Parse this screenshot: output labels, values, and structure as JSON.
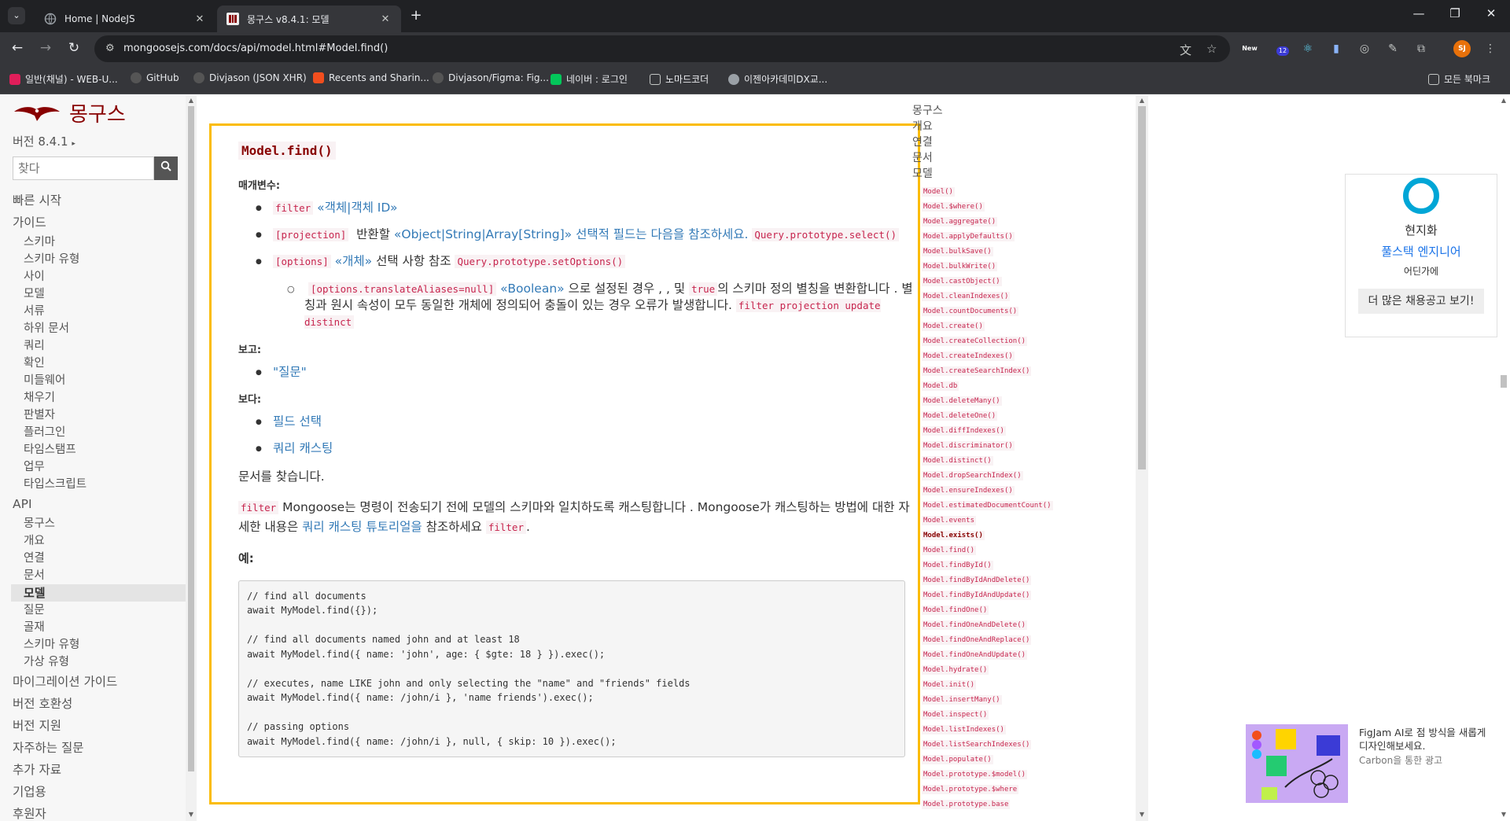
{
  "tabs": [
    {
      "title": "Home | NodeJS"
    },
    {
      "title": "몽구스 v8.4.1: 모델"
    }
  ],
  "address_bar": {
    "url": "mongoosejs.com/docs/api/model.html#Model.find()"
  },
  "extensions": {
    "new_label": "New",
    "badge_count": "12",
    "profile_initials": "SJ"
  },
  "bookmarks": {
    "items": [
      "일반(채널) - WEB-U...",
      "GitHub",
      "Divjason (JSON XHR)",
      "Recents and Sharin...",
      "Divjason/Figma: Fig...",
      "네이버 : 로그인",
      "노마드코더",
      "이젠아카데미DX교..."
    ],
    "all_bookmarks": "모든 북마크"
  },
  "sidebar": {
    "logo_text": "몽구스",
    "version": "버전 8.4.1",
    "search_placeholder": "찾다",
    "nav": [
      {
        "label": "빠른 시작",
        "level": "top"
      },
      {
        "label": "가이드",
        "level": "top"
      },
      {
        "label": "스키마",
        "level": "sub"
      },
      {
        "label": "스키마 유형",
        "level": "sub"
      },
      {
        "label": "사이",
        "level": "sub"
      },
      {
        "label": "모델",
        "level": "sub"
      },
      {
        "label": "서류",
        "level": "sub"
      },
      {
        "label": "하위 문서",
        "level": "sub"
      },
      {
        "label": "쿼리",
        "level": "sub"
      },
      {
        "label": "확인",
        "level": "sub"
      },
      {
        "label": "미들웨어",
        "level": "sub"
      },
      {
        "label": "채우기",
        "level": "sub"
      },
      {
        "label": "판별자",
        "level": "sub"
      },
      {
        "label": "플러그인",
        "level": "sub"
      },
      {
        "label": "타임스탬프",
        "level": "sub"
      },
      {
        "label": "업무",
        "level": "sub"
      },
      {
        "label": "타입스크립트",
        "level": "sub"
      },
      {
        "label": "API",
        "level": "top"
      },
      {
        "label": "몽구스",
        "level": "sub"
      },
      {
        "label": "개요",
        "level": "sub"
      },
      {
        "label": "연결",
        "level": "sub"
      },
      {
        "label": "문서",
        "level": "sub"
      },
      {
        "label": "모델",
        "level": "sel"
      },
      {
        "label": "질문",
        "level": "sub"
      },
      {
        "label": "골재",
        "level": "sub"
      },
      {
        "label": "스키마 유형",
        "level": "sub"
      },
      {
        "label": "가상 유형",
        "level": "sub"
      },
      {
        "label": "마이그레이션 가이드",
        "level": "top"
      },
      {
        "label": "버전 호환성",
        "level": "top"
      },
      {
        "label": "버전 지원",
        "level": "top"
      },
      {
        "label": "자주하는 질문",
        "level": "top"
      },
      {
        "label": "추가 자료",
        "level": "top"
      },
      {
        "label": "기업용",
        "level": "top"
      },
      {
        "label": "후원자",
        "level": "top"
      }
    ]
  },
  "content": {
    "heading": "Model.find()",
    "params_label": "매개변수:",
    "p1": {
      "name": "filter",
      "type": "«객체|객체 ID»"
    },
    "p2": {
      "name": "[projection]",
      "text": "반환할",
      "type": "«Object|String|Array[String]»",
      "desc": "선택적 필드는 다음을 참조하세요.",
      "code": "Query.prototype.select()"
    },
    "p3": {
      "name": "[options]",
      "type": "«개체»",
      "desc": "선택 사항 참조",
      "code": "Query.prototype.setOptions()"
    },
    "p3a": {
      "name": "[options.translateAliases=null]",
      "type": "«Boolean»",
      "t1": "으로 설정된 경우 , , 및",
      "code_true": "true",
      "t2": "의 스키마 정의 별칭을 변환합니다 .",
      "t3": "별칭과 원시 속성이 모두 동일한 개체에 정의되어 충돌이 있는 경우 오류가 발생합니다.",
      "codes": "filter projection update distinct"
    },
    "returns_label": "보고:",
    "returns_item": "\"질문\"",
    "see_label": "보다:",
    "see_items": [
      "필드 선택",
      "쿼리 캐스팅"
    ],
    "desc": "문서를 찾습니다.",
    "cast": {
      "code1": "filter",
      "t1": "Mongoose는 명령이 전송되기 전에 모델의 스키마와 일치하도록 캐스팅합니다 . Mongoose가 캐스팅하는 방법에 대한 자세한 내용은",
      "link": "쿼리 캐스팅 튜토리얼을",
      "t2": "참조하세요",
      "code2": "filter",
      "t3": "."
    },
    "example_label": "예:",
    "example_code": "// find all documents\nawait MyModel.find({});\n\n// find all documents named john and at least 18\nawait MyModel.find({ name: 'john', age: { $gte: 18 } }).exec();\n\n// executes, name LIKE john and only selecting the \"name\" and \"friends\" fields\nawait MyModel.find({ name: /john/i }, 'name friends').exec();\n\n// passing options\nawait MyModel.find({ name: /john/i }, null, { skip: 10 }).exec();"
  },
  "api_index": {
    "top_links": [
      "몽구스",
      "개요",
      "연결",
      "문서",
      "모델"
    ],
    "methods": [
      "Model()",
      "Model.$where()",
      "Model.aggregate()",
      "Model.applyDefaults()",
      "Model.bulkSave()",
      "Model.bulkWrite()",
      "Model.castObject()",
      "Model.cleanIndexes()",
      "Model.countDocuments()",
      "Model.create()",
      "Model.createCollection()",
      "Model.createIndexes()",
      "Model.createSearchIndex()",
      "Model.db",
      "Model.deleteMany()",
      "Model.deleteOne()",
      "Model.diffIndexes()",
      "Model.discriminator()",
      "Model.distinct()",
      "Model.dropSearchIndex()",
      "Model.ensureIndexes()",
      "Model.estimatedDocumentCount()",
      "Model.events",
      "Model.exists()",
      "Model.find()",
      "Model.findById()",
      "Model.findByIdAndDelete()",
      "Model.findByIdAndUpdate()",
      "Model.findOne()",
      "Model.findOneAndDelete()",
      "Model.findOneAndReplace()",
      "Model.findOneAndUpdate()",
      "Model.hydrate()",
      "Model.init()",
      "Model.insertMany()",
      "Model.inspect()",
      "Model.listIndexes()",
      "Model.listSearchIndexes()",
      "Model.populate()",
      "Model.prototype.$model()",
      "Model.prototype.$where",
      "Model.prototype.base"
    ],
    "current_method": "Model.exists()"
  },
  "job_card": {
    "company": "현지화",
    "role": "풀스택 엔지니어",
    "location": "어딘가에",
    "button": "더 많은 채용공고 보기!"
  },
  "ad": {
    "text": "FigJam AI로 점 방식을 새롭게 디자인해보세요.",
    "via": "Carbon을 통한 광고"
  }
}
